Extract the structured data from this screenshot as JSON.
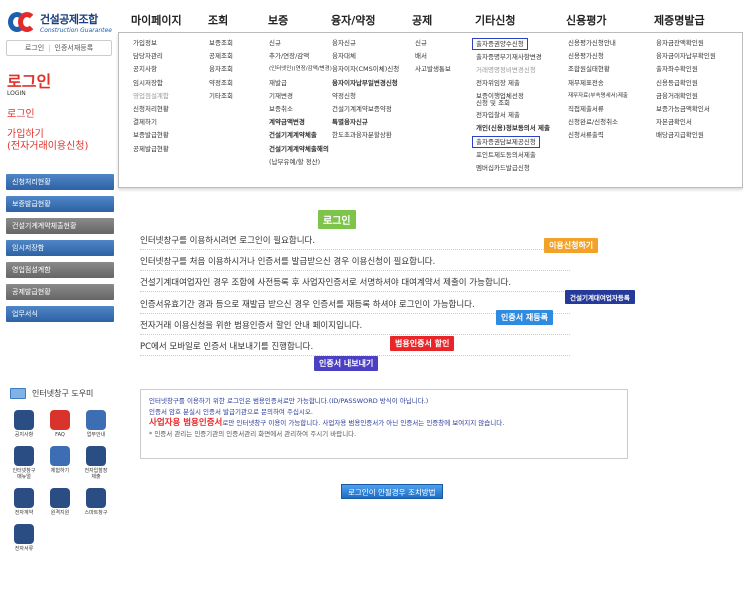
{
  "brand": {
    "name": "건설공제조합",
    "sub": "Construction Guarantee",
    "colors": {
      "blue": "#1b5fae",
      "red": "#e32b2b"
    }
  },
  "left": {
    "tab_login": "로그인",
    "tab_cert": "인증서재등록",
    "title": "로그인",
    "subtitle": "LOGIN",
    "link_login": "로그인",
    "link_join": "가입하기\n(전자거래이용신청)"
  },
  "side_menu": [
    {
      "label": "신청처리현황",
      "style": "blue"
    },
    {
      "label": "보증발급현황",
      "style": "blue"
    },
    {
      "label": "건설기계계약체출현황",
      "style": "gray"
    },
    {
      "label": "임시저장함",
      "style": "blue"
    },
    {
      "label": "영업점설계함",
      "style": "gray"
    },
    {
      "label": "공제발급현황",
      "style": "gray"
    },
    {
      "label": "업무서식",
      "style": "blue"
    }
  ],
  "help": {
    "title": "인터넷창구 도우미",
    "items": [
      {
        "icon": "notice-icon",
        "label": "공지사항"
      },
      {
        "icon": "faq-icon",
        "label": "FAQ"
      },
      {
        "icon": "guide-icon",
        "label": "업무안내"
      },
      {
        "icon": "manual-icon",
        "label": "인터넷창구\n매뉴얼"
      },
      {
        "icon": "experience-icon",
        "label": "체험하기"
      },
      {
        "icon": "e-submit-icon",
        "label": "전자입찰장\n제출"
      },
      {
        "icon": "e-contract-icon",
        "label": "전자계약"
      },
      {
        "icon": "remote-support-icon",
        "label": "원격지원"
      },
      {
        "icon": "smart-window-icon",
        "label": "스마트창구"
      },
      {
        "icon": "e-document-icon",
        "label": "전자서류"
      }
    ]
  },
  "nav": {
    "headers": [
      "마이페이지",
      "조회",
      "보증",
      "융자/약정",
      "공제",
      "기타신청",
      "신용평가",
      "제증명발급"
    ],
    "columns": [
      [
        "가입정보",
        "담당자관리",
        "공지사항",
        "임시저장함",
        "영업점설계함",
        "신청처리현황",
        "결제하기",
        "보증발급현황",
        "공제발급현황"
      ],
      [
        "보증조회",
        "공제조회",
        "융자조회",
        "약정조회",
        "기타조회"
      ],
      [
        "신규",
        "추가/연장/감액",
        "(인터넷인)(연장/감액/변경)",
        "재발급",
        "기재변경",
        "보증취소",
        "계약금액변경",
        "건설기계계약체출",
        "건설기계계약체출해의",
        "(납부유예/할 정산)"
      ],
      [
        "융자신규",
        "융자대체",
        "융자이자(CMS이체)신청",
        "융자이자납부일변경신청",
        "약정신청",
        "건설기계계약보증약정",
        "특별융자신규",
        "한도초과융자분할상환"
      ],
      [
        "신규",
        "배서",
        "사고발생통보"
      ],
      [
        "출자증권양수신청",
        "출자증명부기재사항변경",
        "거래명명정비변경신청",
        "전자위임장 제출",
        "보증이행업체선정\n신청 및 조회",
        "전자입찰서 제출",
        "개인(신용)정보동의서 제출",
        "출자증권담보제공신청",
        "포인트제도동의서제출",
        "멤버십카드발급신청"
      ],
      [
        "신용평가신청안내",
        "신용평가신청",
        "조합원실태현황",
        "재무제표전송",
        "재무자료(부속명세서)제출",
        "직접제출서류",
        "신청완료/신청취소",
        "신청서류출력"
      ],
      [
        "융자금잔액확인원",
        "융자금이자납부확인원",
        "출자좌수확인원",
        "신용등급확인원",
        "금융거래확인원",
        "보증가능금액확인서",
        "자본금확인서",
        "배당금지급확인원"
      ]
    ]
  },
  "main": {
    "tag_login": "로그인",
    "line1": "인터넷창구를 이용하시려면 로그인이 필요합니다.",
    "line2": "인터넷창구를 처음 이용하시거나 인증서를 발급받으신 경우 이용신청이 필요합니다.",
    "line3": "건설기계대여업자인 경우 조합에 사전등록 후 사업자인증서로 서명하셔야 대여계약서 제출이 가능합니다.",
    "line4": "인증서유효기간 경과 등으로 재발급 받으신 경우 인증서를 재등록 하셔야 로그인이 가능합니다.",
    "line5": "전자거래 이용신청을 위한 범용인증서 할인 안내 페이지입니다.",
    "line6": "PC에서 모바일로 인증서 내보내기를 진행합니다.",
    "tag_apply": "이용신청하기",
    "tag_rental": "건설기계대여업자등록",
    "tag_rereg": "인증서 재등록",
    "tag_discount": "범용인증서 할인",
    "tag_export": "인증서 내보내기"
  },
  "notice": {
    "l1": "인터넷창구를 이용하기 위한 로그인은 범용인증서로만 가능합니다.(ID/PASSWORD 방식이 아닙니다.)",
    "l2": "인증서 암호 분실시 인증서 발급기관으로 문의하여 주십시오.",
    "l3_red": "사업자용 범용인증서",
    "l3": "로만 인터넷창구 이용이 가능합니다. 사업자용 범용인증서가 아닌 인증서는 인증창에 보여지지 않습니다.",
    "l4": "* 인증서 관리는 인증기관의 인증서관리 화면에서 관리하여 주시기 바랍니다."
  },
  "guide_button": "로그인이 안될경우 조치방법"
}
